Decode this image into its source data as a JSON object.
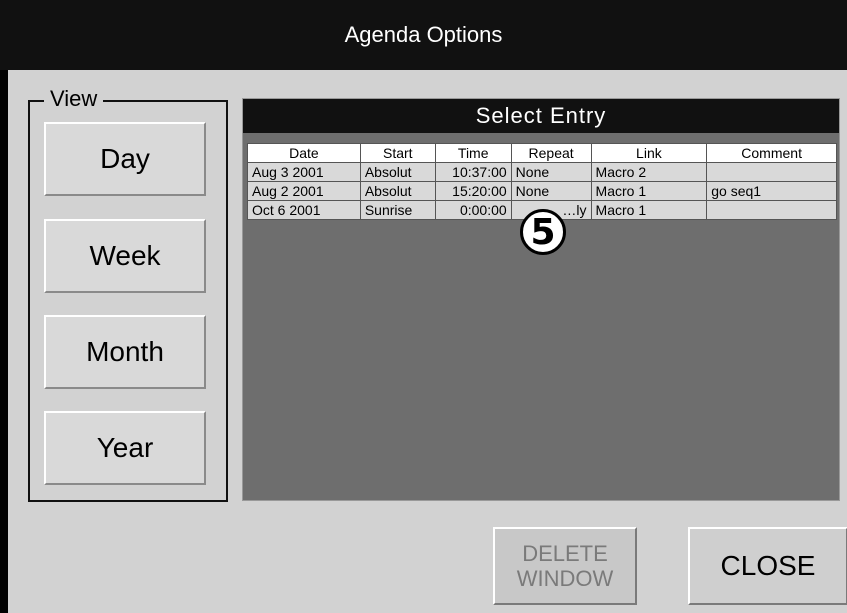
{
  "window": {
    "title": "Agenda Options"
  },
  "view": {
    "legend": "View",
    "buttons": [
      "Day",
      "Week",
      "Month",
      "Year"
    ]
  },
  "entries": {
    "title": "Select Entry",
    "columns": [
      "Date",
      "Start",
      "Time",
      "Repeat",
      "Link",
      "Comment"
    ],
    "rows": [
      [
        "Aug 3 2001",
        "Absolut",
        "10:37:00",
        "None",
        "Macro 2",
        ""
      ],
      [
        "Aug 2 2001",
        "Absolut",
        "15:20:00",
        "None",
        "Macro 1",
        "go seq1"
      ],
      [
        "Oct 6 2001",
        "Sunrise",
        "0:00:00",
        "…ly",
        "Macro 1",
        ""
      ]
    ]
  },
  "badge": {
    "number": "5"
  },
  "actions": {
    "delete_line1": "DELETE",
    "delete_line2": "WINDOW",
    "close": "CLOSE"
  }
}
